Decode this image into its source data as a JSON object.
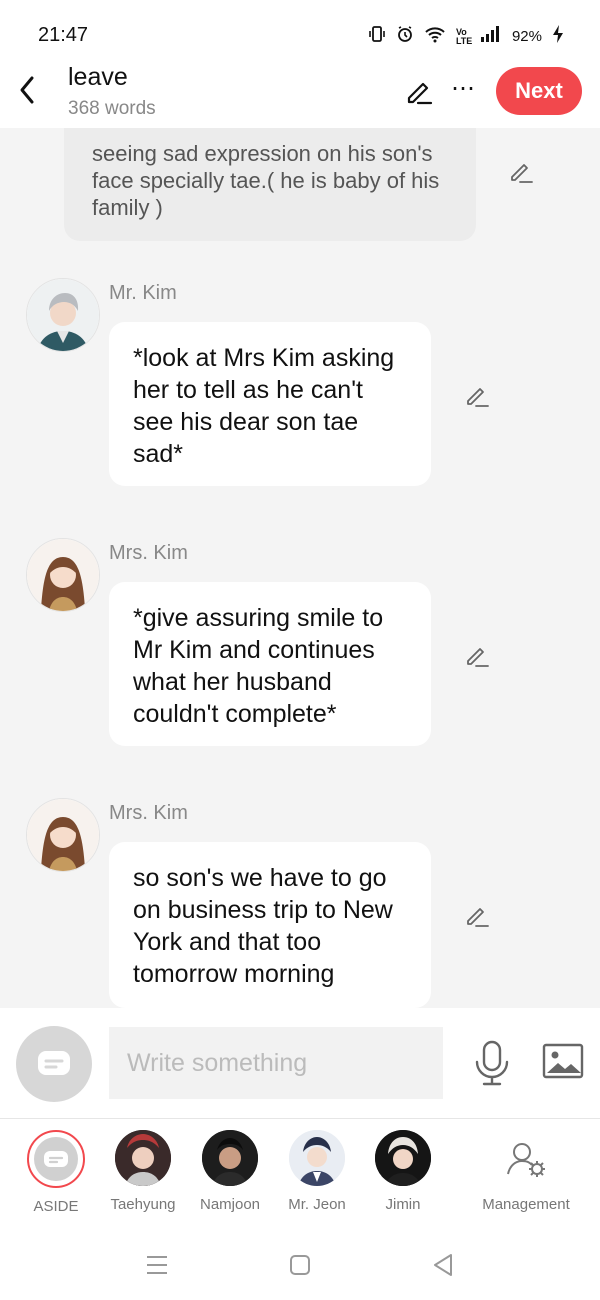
{
  "status_bar": {
    "time": "21:47",
    "battery": "92%",
    "network": "Vo LTE"
  },
  "header": {
    "title": "leave",
    "word_count": "368 words",
    "next_label": "Next"
  },
  "narration": {
    "text": "seeing sad expression on his son's face specially tae.( he is baby of his family )"
  },
  "messages": [
    {
      "name": "Mr. Kim",
      "text": "*look at Mrs Kim asking her to tell as he can't see his dear son tae sad*"
    },
    {
      "name": "Mrs. Kim",
      "text": "*give assuring smile to Mr Kim and continues what her husband couldn't complete*"
    },
    {
      "name": "Mrs. Kim",
      "text": "so son's we have to go on business trip to New York and that too tomorrow morning"
    }
  ],
  "composer": {
    "placeholder": "Write something"
  },
  "characters": [
    {
      "label": "ASIDE"
    },
    {
      "label": "Taehyung"
    },
    {
      "label": "Namjoon"
    },
    {
      "label": "Mr. Jeon"
    },
    {
      "label": "Jimin"
    },
    {
      "label": "Management"
    }
  ],
  "colors": {
    "accent": "#f2484d",
    "background": "#f4f4f4",
    "bubble": "#ffffff",
    "narration_bg": "#ececec"
  },
  "icons": [
    "back-icon",
    "pencil-icon",
    "more-icon",
    "mic-icon",
    "image-icon",
    "aside-icon",
    "management-icon",
    "recents-icon",
    "home-icon",
    "back-nav-icon"
  ]
}
